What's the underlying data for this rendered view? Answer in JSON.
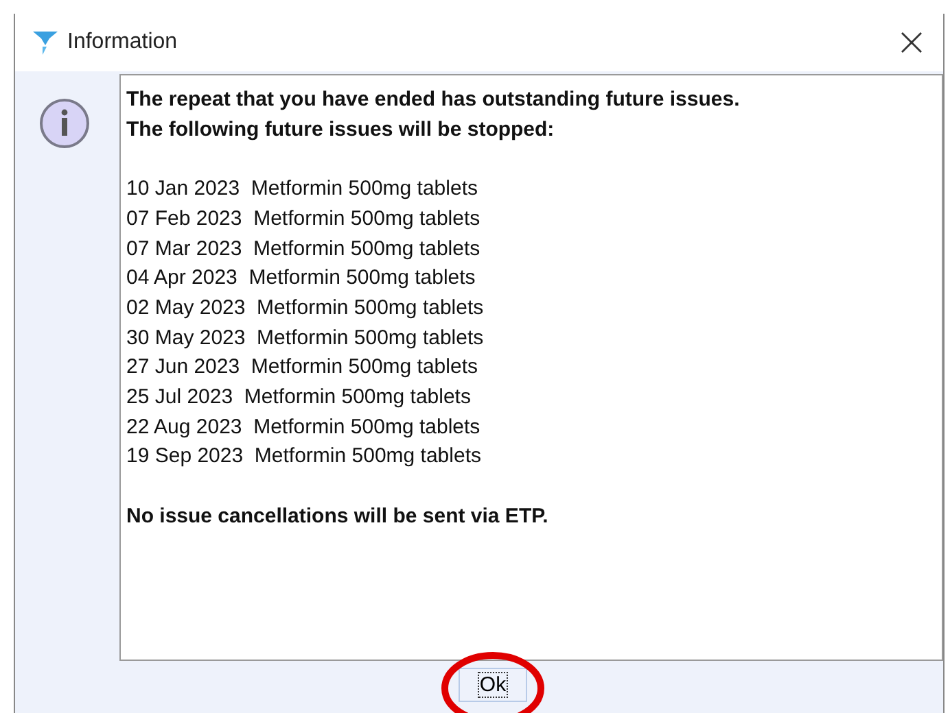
{
  "window": {
    "title": "Information"
  },
  "message": {
    "heading": [
      "The repeat that you have ended has outstanding future issues.",
      "The following future issues will be stopped:"
    ],
    "issues": [
      {
        "date": "10 Jan 2023",
        "item": "Metformin 500mg tablets"
      },
      {
        "date": "07 Feb 2023",
        "item": "Metformin 500mg tablets"
      },
      {
        "date": "07 Mar 2023",
        "item": "Metformin 500mg tablets"
      },
      {
        "date": "04 Apr 2023",
        "item": "Metformin 500mg tablets"
      },
      {
        "date": "02 May 2023",
        "item": "Metformin 500mg tablets"
      },
      {
        "date": "30 May 2023",
        "item": "Metformin 500mg tablets"
      },
      {
        "date": "27 Jun 2023",
        "item": "Metformin 500mg tablets"
      },
      {
        "date": "25 Jul 2023",
        "item": "Metformin 500mg tablets"
      },
      {
        "date": "22 Aug 2023",
        "item": "Metformin 500mg tablets"
      },
      {
        "date": "19 Sep 2023",
        "item": "Metformin 500mg tablets"
      }
    ],
    "footer": "No issue cancellations will be sent via ETP."
  },
  "buttons": [
    {
      "label": "Ok",
      "focused": true,
      "circled": true
    }
  ]
}
